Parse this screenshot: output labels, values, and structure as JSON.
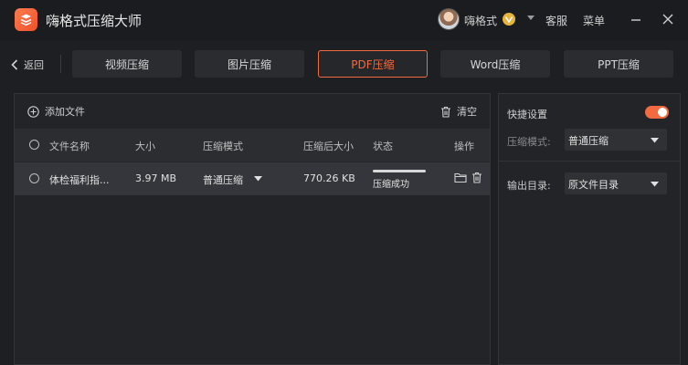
{
  "app": {
    "title": "嗨格式压缩大师"
  },
  "user": {
    "name": "嗨格式"
  },
  "header_links": {
    "service": "客服",
    "menu": "菜单"
  },
  "nav": {
    "back_label": "返回",
    "tabs": [
      {
        "label": "视频压缩",
        "active": false
      },
      {
        "label": "图片压缩",
        "active": false
      },
      {
        "label": "PDF压缩",
        "active": true
      },
      {
        "label": "Word压缩",
        "active": false
      },
      {
        "label": "PPT压缩",
        "active": false
      }
    ]
  },
  "toolbar": {
    "add_file_label": "添加文件",
    "clear_label": "清空"
  },
  "table": {
    "headers": {
      "filename": "文件名称",
      "size": "大小",
      "mode": "压缩模式",
      "compressed_size": "压缩后大小",
      "status": "状态",
      "actions": "操作"
    },
    "rows": [
      {
        "filename": "体检福利指...",
        "size": "3.97 MB",
        "mode": "普通压缩",
        "compressed_size": "770.26 KB",
        "status": "压缩成功",
        "progress": 1.0
      }
    ]
  },
  "settings": {
    "title": "快捷设置",
    "quick_enabled": true,
    "mode_label": "压缩模式:",
    "mode_value": "普通压缩",
    "output_label": "输出目录:",
    "output_value": "原文件目录"
  },
  "colors": {
    "accent": "#f26a3f",
    "background": "#1e1f22",
    "panel": "#232428",
    "vip": "#e8b33b"
  },
  "icons": [
    "app-logo-icon",
    "back-arrow-icon",
    "plus-circle-icon",
    "trash-icon",
    "folder-icon",
    "vip-icon",
    "minimize-icon",
    "close-icon",
    "caret-down-icon"
  ]
}
